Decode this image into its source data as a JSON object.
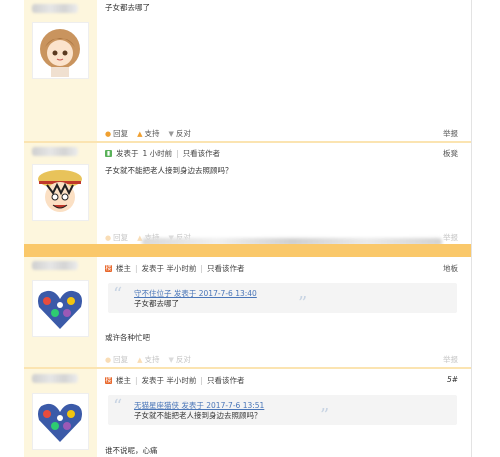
{
  "posts": [
    {
      "text": "子女都去哪了",
      "actions": {
        "reply": "回复",
        "support": "支持",
        "oppose": "反对"
      },
      "report": "举报"
    },
    {
      "meta": {
        "floor_prefix": "发表于",
        "time": "1 小时前",
        "only_author": "只看该作者"
      },
      "floor_label": "板凳",
      "text": "子女就不能把老人接到身边去照顾吗？",
      "actions": {
        "reply": "回复",
        "support": "支持",
        "oppose": "反对"
      },
      "report": "举报"
    },
    {
      "meta": {
        "owner": "楼主",
        "posted": "发表于 半小时前",
        "only_author": "只看该作者"
      },
      "floor_label": "地板",
      "quote": {
        "line1": "守不住位子 发表于 2017-7-6 13:40",
        "line2": "子女都去哪了"
      },
      "text": "或许各种忙吧",
      "actions": {
        "reply": "回复",
        "support": "支持",
        "oppose": "反对"
      },
      "report": "举报"
    },
    {
      "meta": {
        "owner": "楼主",
        "posted": "发表于 半小时前",
        "only_author": "只看该作者"
      },
      "floor_label": "5#",
      "quote": {
        "line1": "无猫星座猫侠 发表于 2017-7-6 13:51",
        "line2": "子女就不能把老人接到身边去照顾吗？"
      },
      "text": "谁不说呢，心痛"
    }
  ],
  "icons": {
    "reply": "reply-bubble-icon",
    "support": "thumb-up-arrow-icon",
    "oppose": "thumb-down-arrow-icon",
    "mobile": "mobile-post-icon",
    "owner": "owner-badge-icon"
  },
  "colors": {
    "sidebar": "#fdf6dd",
    "separator": "#fbe4b1",
    "gap_bar": "#fac86a",
    "link": "#4a76b8"
  }
}
